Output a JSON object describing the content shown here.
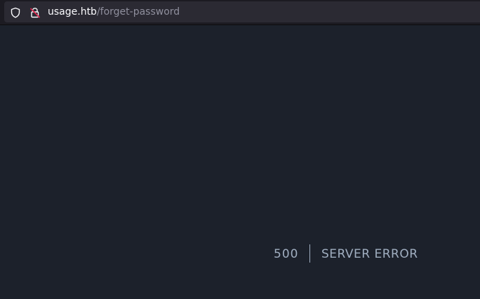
{
  "browser": {
    "url_host": "usage.htb",
    "url_path": "/forget-password",
    "icons": [
      "shield-icon",
      "lock-warning-icon"
    ]
  },
  "error": {
    "code": "500",
    "message": "SERVER ERROR"
  },
  "colors": {
    "page_background": "#1c212b",
    "urlbar_background": "#2b2a33",
    "error_text": "#a0aec0",
    "lock_warning": "#e22850"
  }
}
